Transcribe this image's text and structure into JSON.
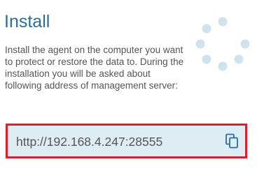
{
  "install": {
    "title": "Install",
    "description": "Install the agent on the computer you want to protect or restore the data to. During the installation you will be asked about following address of management server:",
    "server_address": "http://192.168.4.247:28555"
  },
  "icons": {
    "spinner": "loading-spinner-icon",
    "copy": "copy-icon"
  },
  "colors": {
    "title": "#2a6f9b",
    "text": "#555555",
    "url_box_background": "#deedf4",
    "highlight_border": "#d9202e",
    "copy_icon": "#2a6f9b",
    "spinner_dots": "#cfe3ee"
  }
}
